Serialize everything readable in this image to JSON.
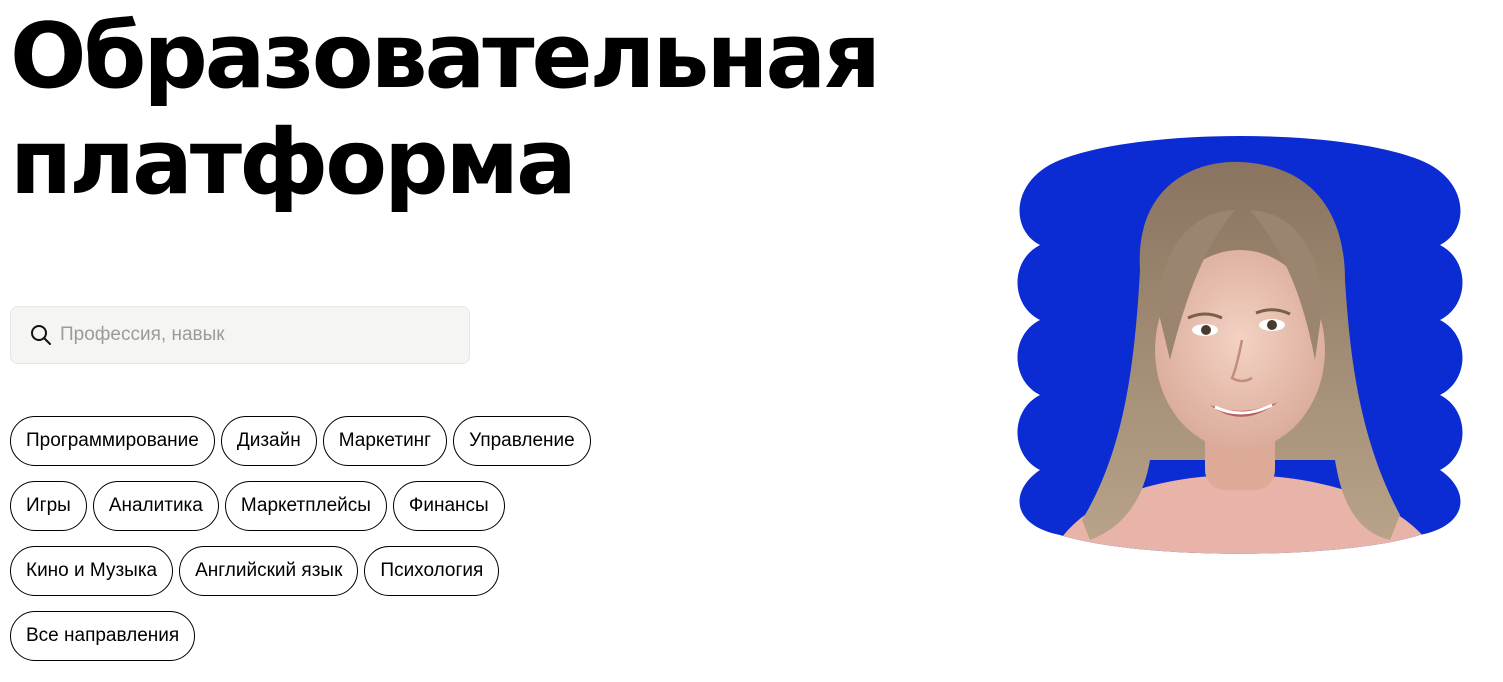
{
  "hero": {
    "title_line1": "Образовательная",
    "title_line2": "платформа",
    "accent_color": "#0a2cd2"
  },
  "search": {
    "placeholder": "Профессия, навык",
    "icon": "search-icon"
  },
  "categories": {
    "row1": [
      "Программирование",
      "Дизайн",
      "Маркетинг",
      "Управление"
    ],
    "row2": [
      "Игры",
      "Аналитика",
      "Маркетплейсы",
      "Финансы"
    ],
    "row3": [
      "Кино и Музыка",
      "Английский язык",
      "Психология"
    ],
    "row4": [
      "Все направления"
    ]
  }
}
